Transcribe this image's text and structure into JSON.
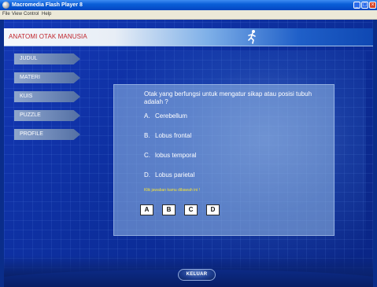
{
  "window": {
    "title": "Macromedia Flash Player 8",
    "icon": "flash-player-icon",
    "buttons": {
      "minimize": "_",
      "maximize": "□",
      "close": "×"
    }
  },
  "menu": {
    "items": [
      "File",
      "View",
      "Control",
      "Help"
    ]
  },
  "header": {
    "title": "ANATOMI OTAK MANUSIA",
    "logo_icon": "running-figure-icon"
  },
  "nav": {
    "items": [
      {
        "label": "JUDUL"
      },
      {
        "label": "MATERI"
      },
      {
        "label": "KUIS"
      },
      {
        "label": "PUZZLE"
      },
      {
        "label": "PROFILE"
      }
    ]
  },
  "quiz": {
    "question": "Otak yang berfungsi untuk mengatur sikap atau posisi tubuh adalah ?",
    "options": [
      {
        "letter": "A.",
        "text": "Cerebellum"
      },
      {
        "letter": "B.",
        "text": "Lobus frontal"
      },
      {
        "letter": "C.",
        "text": "lobus temporal"
      },
      {
        "letter": "D.",
        "text": "Lobus parietal"
      }
    ],
    "hint": "Klik jawaban kamu dibawah ini !",
    "answer_buttons": [
      "A",
      "B",
      "C",
      "D"
    ]
  },
  "footer": {
    "exit_label": "KELUAR"
  },
  "colors": {
    "header_title": "#c0242b",
    "hint": "#f2e23a",
    "stage_background": "#0d2f9e"
  }
}
